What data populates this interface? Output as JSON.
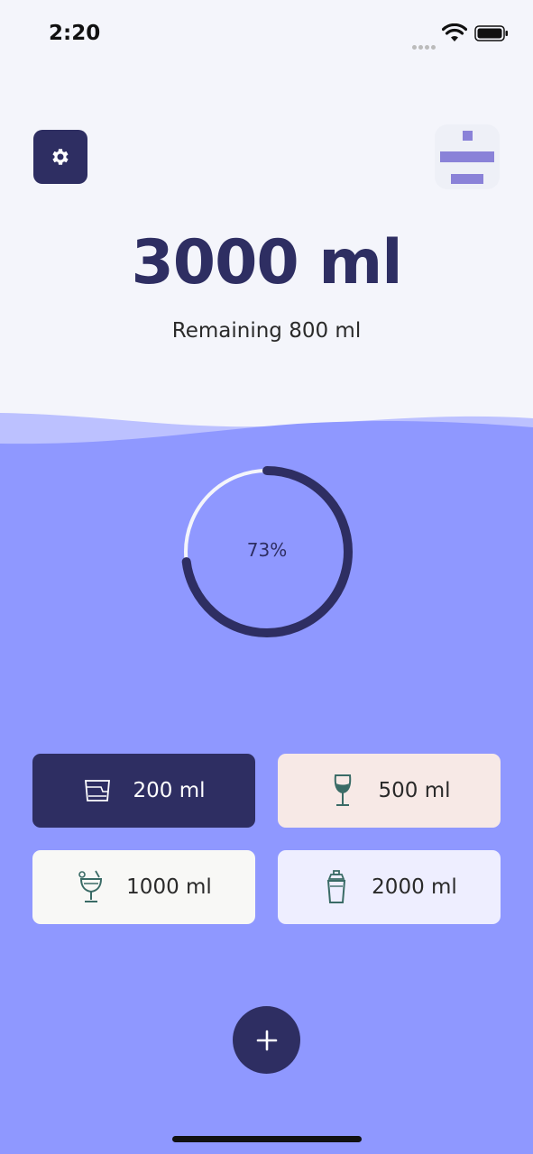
{
  "status_bar": {
    "time": "2:20"
  },
  "header": {
    "goal": "3000 ml",
    "remaining": "Remaining 800 ml"
  },
  "progress": {
    "label": "73%",
    "value": 0.73
  },
  "drinks": [
    {
      "label": "200 ml",
      "icon": "cup-icon"
    },
    {
      "label": "500 ml",
      "icon": "wine-glass-icon"
    },
    {
      "label": "1000 ml",
      "icon": "cocktail-icon"
    },
    {
      "label": "2000 ml",
      "icon": "shaker-icon"
    }
  ],
  "icons": {
    "settings": "gear-icon",
    "logo": "app-logo-icon",
    "add": "plus-icon"
  },
  "colors": {
    "primary": "#2e2e62",
    "water": "#8f98ff",
    "background": "#f4f5fb"
  }
}
